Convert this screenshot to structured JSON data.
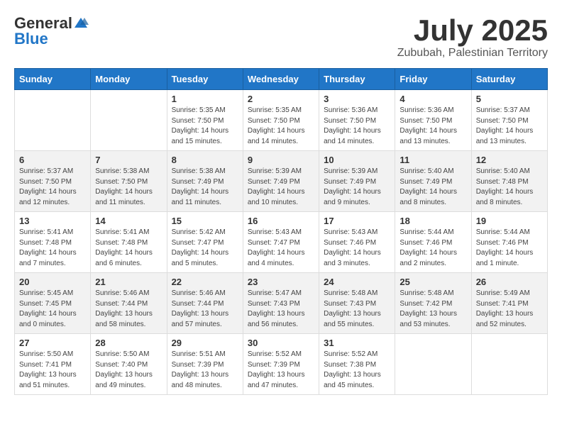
{
  "header": {
    "logo_general": "General",
    "logo_blue": "Blue",
    "month": "July 2025",
    "location": "Zububah, Palestinian Territory"
  },
  "days_of_week": [
    "Sunday",
    "Monday",
    "Tuesday",
    "Wednesday",
    "Thursday",
    "Friday",
    "Saturday"
  ],
  "weeks": [
    [
      {
        "day": "",
        "info": ""
      },
      {
        "day": "",
        "info": ""
      },
      {
        "day": "1",
        "info": "Sunrise: 5:35 AM\nSunset: 7:50 PM\nDaylight: 14 hours and 15 minutes."
      },
      {
        "day": "2",
        "info": "Sunrise: 5:35 AM\nSunset: 7:50 PM\nDaylight: 14 hours and 14 minutes."
      },
      {
        "day": "3",
        "info": "Sunrise: 5:36 AM\nSunset: 7:50 PM\nDaylight: 14 hours and 14 minutes."
      },
      {
        "day": "4",
        "info": "Sunrise: 5:36 AM\nSunset: 7:50 PM\nDaylight: 14 hours and 13 minutes."
      },
      {
        "day": "5",
        "info": "Sunrise: 5:37 AM\nSunset: 7:50 PM\nDaylight: 14 hours and 13 minutes."
      }
    ],
    [
      {
        "day": "6",
        "info": "Sunrise: 5:37 AM\nSunset: 7:50 PM\nDaylight: 14 hours and 12 minutes."
      },
      {
        "day": "7",
        "info": "Sunrise: 5:38 AM\nSunset: 7:50 PM\nDaylight: 14 hours and 11 minutes."
      },
      {
        "day": "8",
        "info": "Sunrise: 5:38 AM\nSunset: 7:49 PM\nDaylight: 14 hours and 11 minutes."
      },
      {
        "day": "9",
        "info": "Sunrise: 5:39 AM\nSunset: 7:49 PM\nDaylight: 14 hours and 10 minutes."
      },
      {
        "day": "10",
        "info": "Sunrise: 5:39 AM\nSunset: 7:49 PM\nDaylight: 14 hours and 9 minutes."
      },
      {
        "day": "11",
        "info": "Sunrise: 5:40 AM\nSunset: 7:49 PM\nDaylight: 14 hours and 8 minutes."
      },
      {
        "day": "12",
        "info": "Sunrise: 5:40 AM\nSunset: 7:48 PM\nDaylight: 14 hours and 8 minutes."
      }
    ],
    [
      {
        "day": "13",
        "info": "Sunrise: 5:41 AM\nSunset: 7:48 PM\nDaylight: 14 hours and 7 minutes."
      },
      {
        "day": "14",
        "info": "Sunrise: 5:41 AM\nSunset: 7:48 PM\nDaylight: 14 hours and 6 minutes."
      },
      {
        "day": "15",
        "info": "Sunrise: 5:42 AM\nSunset: 7:47 PM\nDaylight: 14 hours and 5 minutes."
      },
      {
        "day": "16",
        "info": "Sunrise: 5:43 AM\nSunset: 7:47 PM\nDaylight: 14 hours and 4 minutes."
      },
      {
        "day": "17",
        "info": "Sunrise: 5:43 AM\nSunset: 7:46 PM\nDaylight: 14 hours and 3 minutes."
      },
      {
        "day": "18",
        "info": "Sunrise: 5:44 AM\nSunset: 7:46 PM\nDaylight: 14 hours and 2 minutes."
      },
      {
        "day": "19",
        "info": "Sunrise: 5:44 AM\nSunset: 7:46 PM\nDaylight: 14 hours and 1 minute."
      }
    ],
    [
      {
        "day": "20",
        "info": "Sunrise: 5:45 AM\nSunset: 7:45 PM\nDaylight: 14 hours and 0 minutes."
      },
      {
        "day": "21",
        "info": "Sunrise: 5:46 AM\nSunset: 7:44 PM\nDaylight: 13 hours and 58 minutes."
      },
      {
        "day": "22",
        "info": "Sunrise: 5:46 AM\nSunset: 7:44 PM\nDaylight: 13 hours and 57 minutes."
      },
      {
        "day": "23",
        "info": "Sunrise: 5:47 AM\nSunset: 7:43 PM\nDaylight: 13 hours and 56 minutes."
      },
      {
        "day": "24",
        "info": "Sunrise: 5:48 AM\nSunset: 7:43 PM\nDaylight: 13 hours and 55 minutes."
      },
      {
        "day": "25",
        "info": "Sunrise: 5:48 AM\nSunset: 7:42 PM\nDaylight: 13 hours and 53 minutes."
      },
      {
        "day": "26",
        "info": "Sunrise: 5:49 AM\nSunset: 7:41 PM\nDaylight: 13 hours and 52 minutes."
      }
    ],
    [
      {
        "day": "27",
        "info": "Sunrise: 5:50 AM\nSunset: 7:41 PM\nDaylight: 13 hours and 51 minutes."
      },
      {
        "day": "28",
        "info": "Sunrise: 5:50 AM\nSunset: 7:40 PM\nDaylight: 13 hours and 49 minutes."
      },
      {
        "day": "29",
        "info": "Sunrise: 5:51 AM\nSunset: 7:39 PM\nDaylight: 13 hours and 48 minutes."
      },
      {
        "day": "30",
        "info": "Sunrise: 5:52 AM\nSunset: 7:39 PM\nDaylight: 13 hours and 47 minutes."
      },
      {
        "day": "31",
        "info": "Sunrise: 5:52 AM\nSunset: 7:38 PM\nDaylight: 13 hours and 45 minutes."
      },
      {
        "day": "",
        "info": ""
      },
      {
        "day": "",
        "info": ""
      }
    ]
  ],
  "gray_weeks": [
    1,
    3
  ]
}
